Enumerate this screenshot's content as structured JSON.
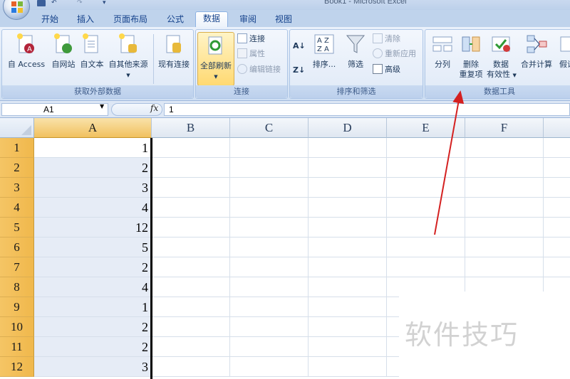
{
  "window": {
    "title": "Book1 - Microsoft Excel"
  },
  "tabs": [
    {
      "label": "开始"
    },
    {
      "label": "插入"
    },
    {
      "label": "页面布局"
    },
    {
      "label": "公式"
    },
    {
      "label": "数据",
      "active": true
    },
    {
      "label": "审阅"
    },
    {
      "label": "视图"
    }
  ],
  "ribbon": {
    "external": {
      "label": "获取外部数据",
      "buttons": [
        "自 Access",
        "自网站",
        "自文本",
        "自其他来源",
        "现有连接"
      ]
    },
    "connections": {
      "label": "连接",
      "refresh_all": "全部刷新",
      "connections": "连接",
      "properties": "属性",
      "edit_links": "编辑链接"
    },
    "sort_filter": {
      "label": "排序和筛选",
      "sort": "排序...",
      "filter": "筛选",
      "clear": "清除",
      "reapply": "重新应用",
      "advanced": "高级"
    },
    "data_tools": {
      "label": "数据工具",
      "text_to_columns": "分列",
      "remove_dup_1": "删除",
      "remove_dup_2": "重复项",
      "validation_1": "数据",
      "validation_2": "有效性",
      "consolidate": "合并计算",
      "what_if": "假设"
    }
  },
  "formula_bar": {
    "name_box": "A1",
    "fx": "fx",
    "value": "1"
  },
  "grid": {
    "columns": [
      "A",
      "B",
      "C",
      "D",
      "E",
      "F"
    ],
    "rows": [
      "1",
      "2",
      "3",
      "4",
      "5",
      "6",
      "7",
      "8",
      "9",
      "10",
      "11",
      "12"
    ],
    "column_a_values": [
      "1",
      "2",
      "3",
      "4",
      "12",
      "5",
      "2",
      "4",
      "1",
      "2",
      "2",
      "3"
    ]
  },
  "watermark": "软件技巧",
  "colors": {
    "ribbon_bg": "#dbe7f6",
    "tab_text": "#15428b",
    "row_header_selected": "#f0b84c",
    "arrow": "#d42020"
  }
}
